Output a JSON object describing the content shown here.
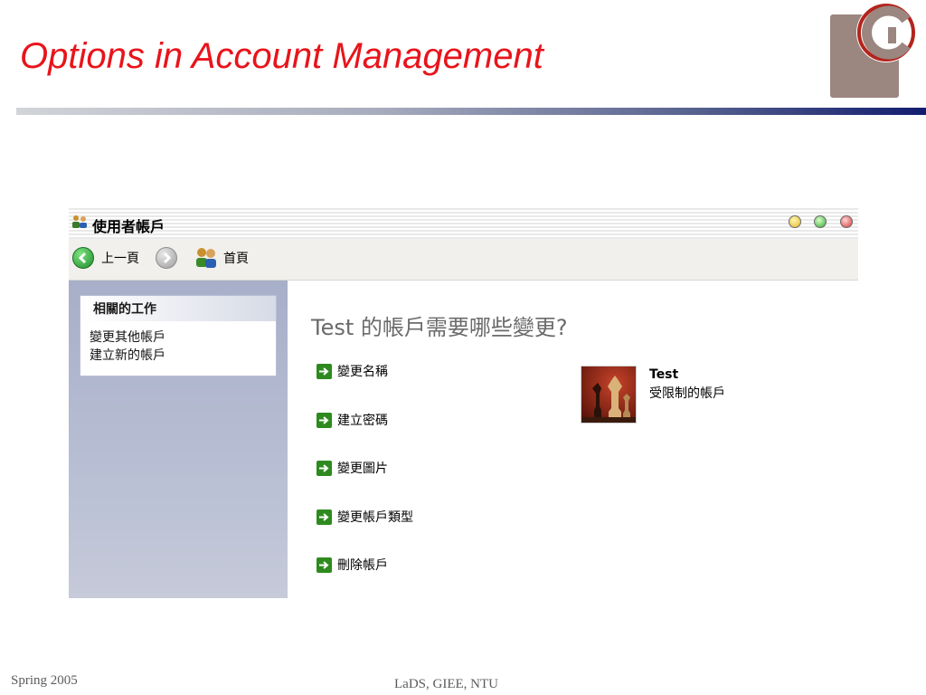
{
  "slide": {
    "title": "Options in Account Management",
    "footer_left": "Spring 2005",
    "footer_center": "LaDS, GIEE, NTU"
  },
  "window": {
    "title": "使用者帳戶",
    "icons": [
      "users-icon",
      "minimize-button",
      "maximize-button",
      "close-button"
    ],
    "toolbar": {
      "back_label": "上一頁",
      "home_label": "首頁"
    },
    "sidebar": {
      "section_title": "相關的工作",
      "links": [
        "變更其他帳戶",
        "建立新的帳戶"
      ]
    },
    "main": {
      "question": "Test 的帳戶需要哪些變更?",
      "actions": [
        "變更名稱",
        "建立密碼",
        "變更圖片",
        "變更帳戶類型",
        "刪除帳戶"
      ],
      "user": {
        "name": "Test",
        "type": "受限制的帳戶",
        "picture_icon": "chess-icon"
      }
    }
  },
  "colors": {
    "title_red": "#e8141b",
    "sidebar_blue": "#a7afc9",
    "action_green": "#2e8a1e"
  }
}
